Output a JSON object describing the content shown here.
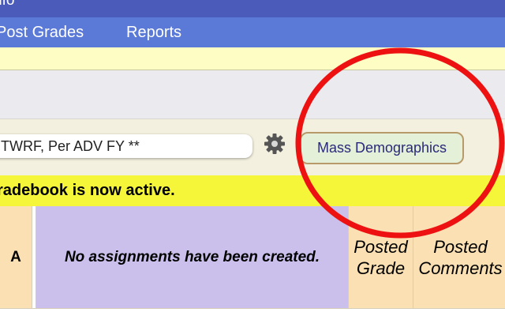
{
  "titlebar": {
    "text": "nfo"
  },
  "nav": {
    "items": [
      "Post Grades",
      "Reports"
    ]
  },
  "toolbar": {
    "class_select_value": "TWRF, Per ADV FY **",
    "settings_icon": "gear-icon",
    "mass_demographics_label": "Mass Demographics"
  },
  "banner": {
    "text": "radebook is now active."
  },
  "grid": {
    "left_header": "A",
    "no_assignments_text": "No assignments have been created.",
    "posted_grade": [
      "Posted",
      "Grade"
    ],
    "posted_comments": [
      "Posted",
      "Comments"
    ]
  },
  "colors": {
    "title_bar": "#4a5bb9",
    "nav_bar": "#5b79d6",
    "notice_strip": "#fdfdc4",
    "active_banner": "#f5f53a",
    "header_tan": "#fae0b2",
    "header_lavender": "#cbbfec",
    "annotation_circle": "#ee1111"
  }
}
